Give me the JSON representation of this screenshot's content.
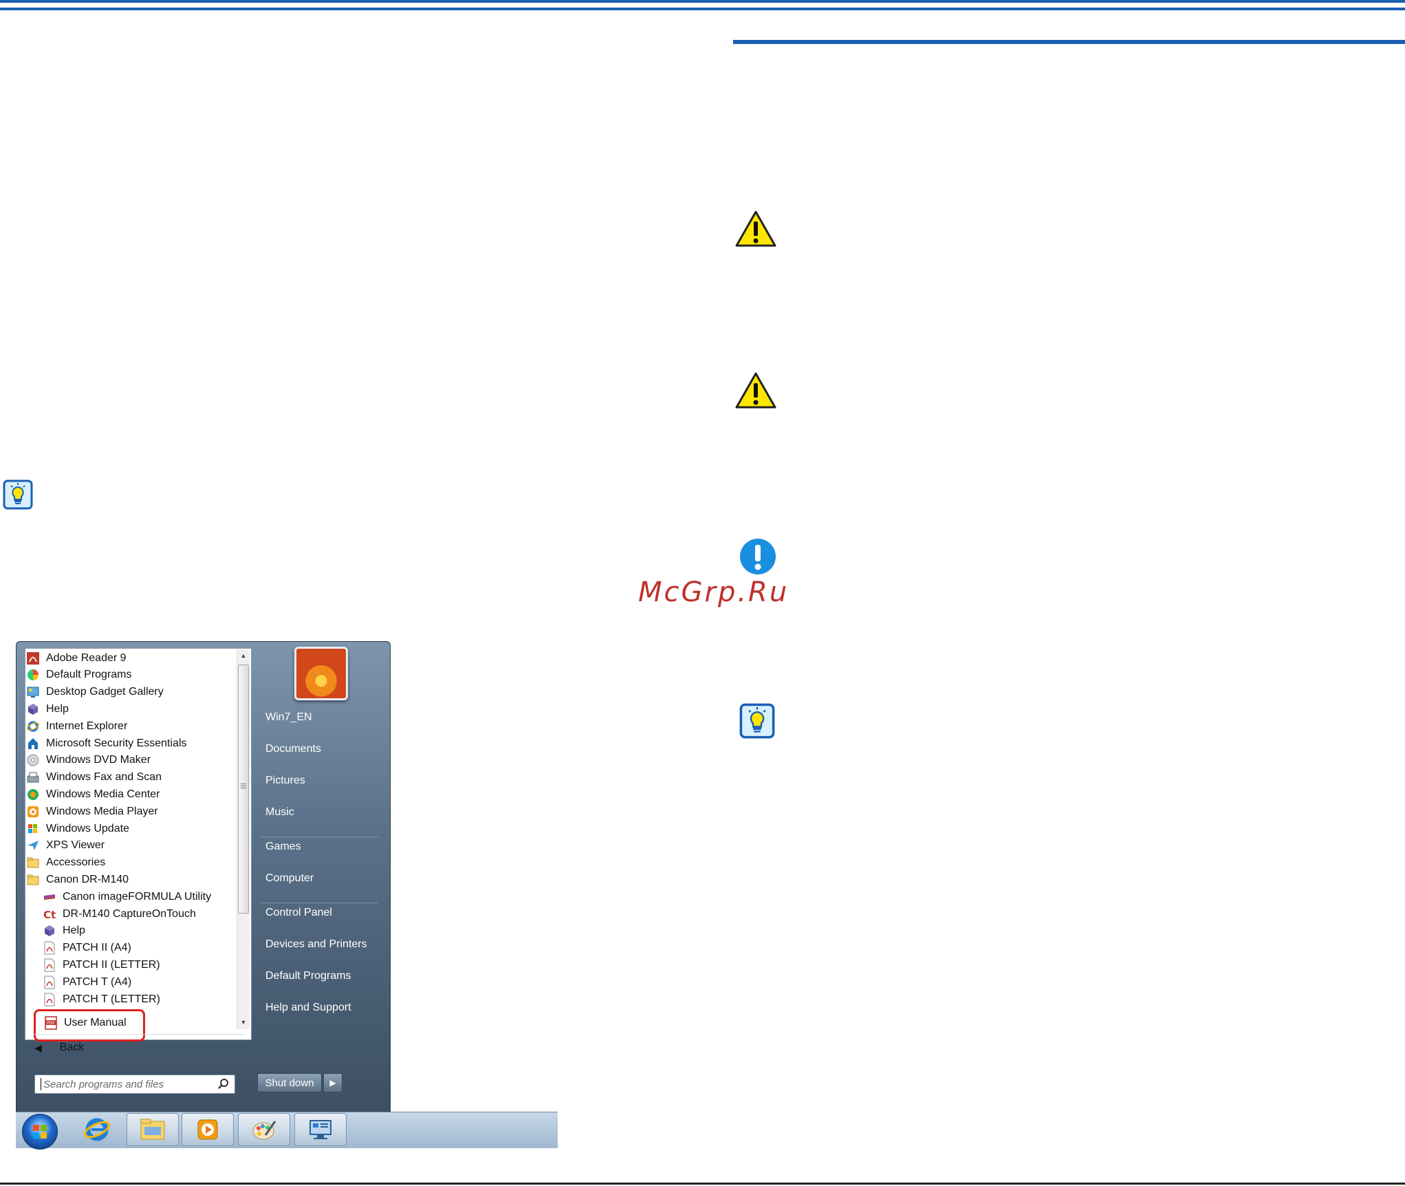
{
  "watermark": "McGrp.Ru",
  "start_menu": {
    "programs": [
      {
        "label": "Adobe Reader 9",
        "icon": "adobe-reader-icon",
        "indent": false
      },
      {
        "label": "Default Programs",
        "icon": "default-programs-icon",
        "indent": false
      },
      {
        "label": "Desktop Gadget Gallery",
        "icon": "gadget-gallery-icon",
        "indent": false
      },
      {
        "label": "Help",
        "icon": "help-book-icon",
        "indent": false
      },
      {
        "label": "Internet Explorer",
        "icon": "internet-explorer-icon",
        "indent": false
      },
      {
        "label": "Microsoft Security Essentials",
        "icon": "security-essentials-icon",
        "indent": false
      },
      {
        "label": "Windows DVD Maker",
        "icon": "dvd-maker-icon",
        "indent": false
      },
      {
        "label": "Windows Fax and Scan",
        "icon": "fax-scan-icon",
        "indent": false
      },
      {
        "label": "Windows Media Center",
        "icon": "media-center-icon",
        "indent": false
      },
      {
        "label": "Windows Media Player",
        "icon": "media-player-icon",
        "indent": false
      },
      {
        "label": "Windows Update",
        "icon": "windows-update-icon",
        "indent": false
      },
      {
        "label": "XPS Viewer",
        "icon": "xps-viewer-icon",
        "indent": false
      },
      {
        "label": "Accessories",
        "icon": "folder-icon",
        "indent": false
      },
      {
        "label": "Canon DR-M140",
        "icon": "folder-icon",
        "indent": false
      },
      {
        "label": "Canon imageFORMULA Utility",
        "icon": "imageformula-icon",
        "indent": true
      },
      {
        "label": "DR-M140 CaptureOnTouch",
        "icon": "captureontouch-icon",
        "indent": true
      },
      {
        "label": "Help",
        "icon": "help-book-icon",
        "indent": true
      },
      {
        "label": "PATCH II (A4)",
        "icon": "pdf-icon",
        "indent": true
      },
      {
        "label": "PATCH II (LETTER)",
        "icon": "pdf-icon",
        "indent": true
      },
      {
        "label": "PATCH T (A4)",
        "icon": "pdf-icon",
        "indent": true
      },
      {
        "label": "PATCH T (LETTER)",
        "icon": "pdf-icon",
        "indent": true
      }
    ],
    "user_manual": "User Manual",
    "back": "Back",
    "search_placeholder": "Search programs and files",
    "right_pane": [
      "Win7_EN",
      "Documents",
      "Pictures",
      "Music",
      "Games",
      "Computer",
      "Control Panel",
      "Devices and Printers",
      "Default Programs",
      "Help and Support"
    ],
    "shutdown": "Shut down"
  },
  "colors": {
    "accent_rule": "#1a5fb4",
    "warning_yellow": "#ffe600",
    "important_blue": "#1a8fe0",
    "highlight_red": "#e02020"
  }
}
